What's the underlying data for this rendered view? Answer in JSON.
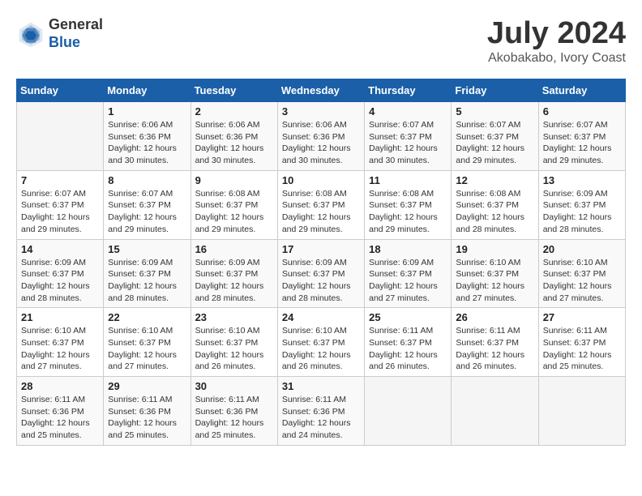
{
  "header": {
    "logo_general": "General",
    "logo_blue": "Blue",
    "month_year": "July 2024",
    "location": "Akobakabo, Ivory Coast"
  },
  "calendar": {
    "days_of_week": [
      "Sunday",
      "Monday",
      "Tuesday",
      "Wednesday",
      "Thursday",
      "Friday",
      "Saturday"
    ],
    "weeks": [
      [
        {
          "day": "",
          "info": ""
        },
        {
          "day": "1",
          "info": "Sunrise: 6:06 AM\nSunset: 6:36 PM\nDaylight: 12 hours\nand 30 minutes."
        },
        {
          "day": "2",
          "info": "Sunrise: 6:06 AM\nSunset: 6:36 PM\nDaylight: 12 hours\nand 30 minutes."
        },
        {
          "day": "3",
          "info": "Sunrise: 6:06 AM\nSunset: 6:36 PM\nDaylight: 12 hours\nand 30 minutes."
        },
        {
          "day": "4",
          "info": "Sunrise: 6:07 AM\nSunset: 6:37 PM\nDaylight: 12 hours\nand 30 minutes."
        },
        {
          "day": "5",
          "info": "Sunrise: 6:07 AM\nSunset: 6:37 PM\nDaylight: 12 hours\nand 29 minutes."
        },
        {
          "day": "6",
          "info": "Sunrise: 6:07 AM\nSunset: 6:37 PM\nDaylight: 12 hours\nand 29 minutes."
        }
      ],
      [
        {
          "day": "7",
          "info": "Sunrise: 6:07 AM\nSunset: 6:37 PM\nDaylight: 12 hours\nand 29 minutes."
        },
        {
          "day": "8",
          "info": "Sunrise: 6:07 AM\nSunset: 6:37 PM\nDaylight: 12 hours\nand 29 minutes."
        },
        {
          "day": "9",
          "info": "Sunrise: 6:08 AM\nSunset: 6:37 PM\nDaylight: 12 hours\nand 29 minutes."
        },
        {
          "day": "10",
          "info": "Sunrise: 6:08 AM\nSunset: 6:37 PM\nDaylight: 12 hours\nand 29 minutes."
        },
        {
          "day": "11",
          "info": "Sunrise: 6:08 AM\nSunset: 6:37 PM\nDaylight: 12 hours\nand 29 minutes."
        },
        {
          "day": "12",
          "info": "Sunrise: 6:08 AM\nSunset: 6:37 PM\nDaylight: 12 hours\nand 28 minutes."
        },
        {
          "day": "13",
          "info": "Sunrise: 6:09 AM\nSunset: 6:37 PM\nDaylight: 12 hours\nand 28 minutes."
        }
      ],
      [
        {
          "day": "14",
          "info": "Sunrise: 6:09 AM\nSunset: 6:37 PM\nDaylight: 12 hours\nand 28 minutes."
        },
        {
          "day": "15",
          "info": "Sunrise: 6:09 AM\nSunset: 6:37 PM\nDaylight: 12 hours\nand 28 minutes."
        },
        {
          "day": "16",
          "info": "Sunrise: 6:09 AM\nSunset: 6:37 PM\nDaylight: 12 hours\nand 28 minutes."
        },
        {
          "day": "17",
          "info": "Sunrise: 6:09 AM\nSunset: 6:37 PM\nDaylight: 12 hours\nand 28 minutes."
        },
        {
          "day": "18",
          "info": "Sunrise: 6:09 AM\nSunset: 6:37 PM\nDaylight: 12 hours\nand 27 minutes."
        },
        {
          "day": "19",
          "info": "Sunrise: 6:10 AM\nSunset: 6:37 PM\nDaylight: 12 hours\nand 27 minutes."
        },
        {
          "day": "20",
          "info": "Sunrise: 6:10 AM\nSunset: 6:37 PM\nDaylight: 12 hours\nand 27 minutes."
        }
      ],
      [
        {
          "day": "21",
          "info": "Sunrise: 6:10 AM\nSunset: 6:37 PM\nDaylight: 12 hours\nand 27 minutes."
        },
        {
          "day": "22",
          "info": "Sunrise: 6:10 AM\nSunset: 6:37 PM\nDaylight: 12 hours\nand 27 minutes."
        },
        {
          "day": "23",
          "info": "Sunrise: 6:10 AM\nSunset: 6:37 PM\nDaylight: 12 hours\nand 26 minutes."
        },
        {
          "day": "24",
          "info": "Sunrise: 6:10 AM\nSunset: 6:37 PM\nDaylight: 12 hours\nand 26 minutes."
        },
        {
          "day": "25",
          "info": "Sunrise: 6:11 AM\nSunset: 6:37 PM\nDaylight: 12 hours\nand 26 minutes."
        },
        {
          "day": "26",
          "info": "Sunrise: 6:11 AM\nSunset: 6:37 PM\nDaylight: 12 hours\nand 26 minutes."
        },
        {
          "day": "27",
          "info": "Sunrise: 6:11 AM\nSunset: 6:37 PM\nDaylight: 12 hours\nand 25 minutes."
        }
      ],
      [
        {
          "day": "28",
          "info": "Sunrise: 6:11 AM\nSunset: 6:36 PM\nDaylight: 12 hours\nand 25 minutes."
        },
        {
          "day": "29",
          "info": "Sunrise: 6:11 AM\nSunset: 6:36 PM\nDaylight: 12 hours\nand 25 minutes."
        },
        {
          "day": "30",
          "info": "Sunrise: 6:11 AM\nSunset: 6:36 PM\nDaylight: 12 hours\nand 25 minutes."
        },
        {
          "day": "31",
          "info": "Sunrise: 6:11 AM\nSunset: 6:36 PM\nDaylight: 12 hours\nand 24 minutes."
        },
        {
          "day": "",
          "info": ""
        },
        {
          "day": "",
          "info": ""
        },
        {
          "day": "",
          "info": ""
        }
      ]
    ]
  }
}
